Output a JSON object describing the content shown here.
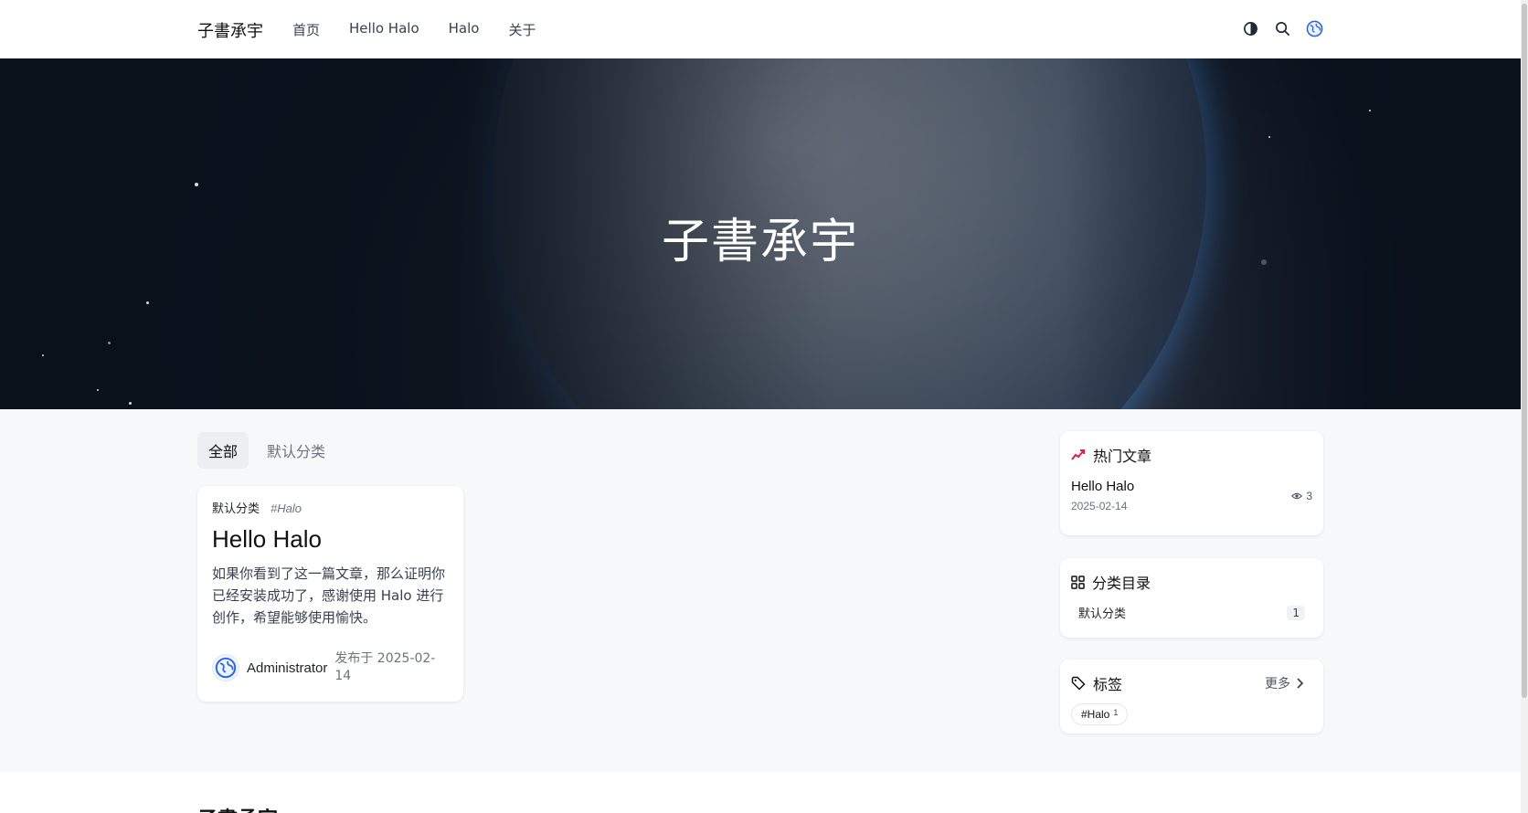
{
  "header": {
    "brand": "子書承宇",
    "nav": [
      "首页",
      "Hello Halo",
      "Halo",
      "关于"
    ],
    "icons": [
      "theme-toggle-icon",
      "search-icon",
      "globe-icon"
    ]
  },
  "hero": {
    "title": "子書承宇"
  },
  "tabs": [
    "全部",
    "默认分类"
  ],
  "post": {
    "category": "默认分类",
    "tag": "#Halo",
    "title": "Hello Halo",
    "excerpt": "如果你看到了这一篇文章，那么证明你已经安装成功了，感谢使用 Halo 进行创作，希望能够使用愉快。",
    "author": "Administrator",
    "published": "发布于 2025-02-14"
  },
  "sidebar": {
    "hot": {
      "title": "热门文章",
      "item_title": "Hello Halo",
      "item_date": "2025-02-14",
      "views": "3"
    },
    "categories": {
      "title": "分类目录",
      "items": [
        {
          "name": "默认分类",
          "count": "1"
        }
      ]
    },
    "tags": {
      "title": "标签",
      "more": "更多",
      "items": [
        {
          "name": "#Halo",
          "count": "1"
        }
      ]
    }
  },
  "footer": {
    "brand": "子書承宇"
  },
  "colors": {
    "accent": "#2563eb",
    "hot_icon": "#e11d48"
  }
}
